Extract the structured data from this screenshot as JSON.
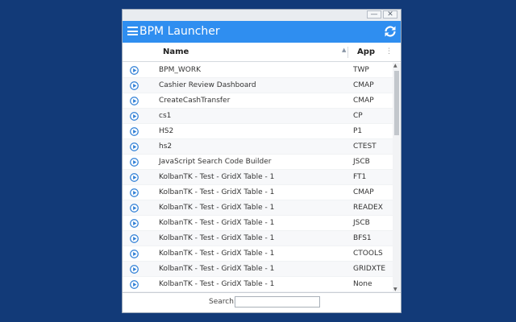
{
  "app": {
    "title": "BPM Launcher"
  },
  "window": {
    "minimize_glyph": "—",
    "close_glyph": "✕"
  },
  "columns": {
    "name": "Name",
    "app": "App",
    "sort_glyph": "▲",
    "menu_glyph": "⋮"
  },
  "rows": [
    {
      "name": "BPM_WORK",
      "app": "TWP"
    },
    {
      "name": "Cashier Review Dashboard",
      "app": "CMAP"
    },
    {
      "name": "CreateCashTransfer",
      "app": "CMAP"
    },
    {
      "name": "cs1",
      "app": "CP"
    },
    {
      "name": "HS2",
      "app": "P1"
    },
    {
      "name": "hs2",
      "app": "CTEST"
    },
    {
      "name": "JavaScript Search Code Builder",
      "app": "JSCB"
    },
    {
      "name": "KolbanTK - Test - GridX Table - 1",
      "app": "FT1"
    },
    {
      "name": "KolbanTK - Test - GridX Table - 1",
      "app": "CMAP"
    },
    {
      "name": "KolbanTK - Test - GridX Table - 1",
      "app": "READEX"
    },
    {
      "name": "KolbanTK - Test - GridX Table - 1",
      "app": "JSCB"
    },
    {
      "name": "KolbanTK - Test - GridX Table - 1",
      "app": "BFS1"
    },
    {
      "name": "KolbanTK - Test - GridX Table - 1",
      "app": "CTOOLS"
    },
    {
      "name": "KolbanTK - Test - GridX Table - 1",
      "app": "GRIDXTE"
    },
    {
      "name": "KolbanTK - Test - GridX Table - 1",
      "app": "None"
    }
  ],
  "search": {
    "label": "Search:",
    "value": "",
    "placeholder": ""
  },
  "colors": {
    "accent": "#2f8ef0",
    "background": "#123a78",
    "play_icon": "#2f7fd6"
  }
}
